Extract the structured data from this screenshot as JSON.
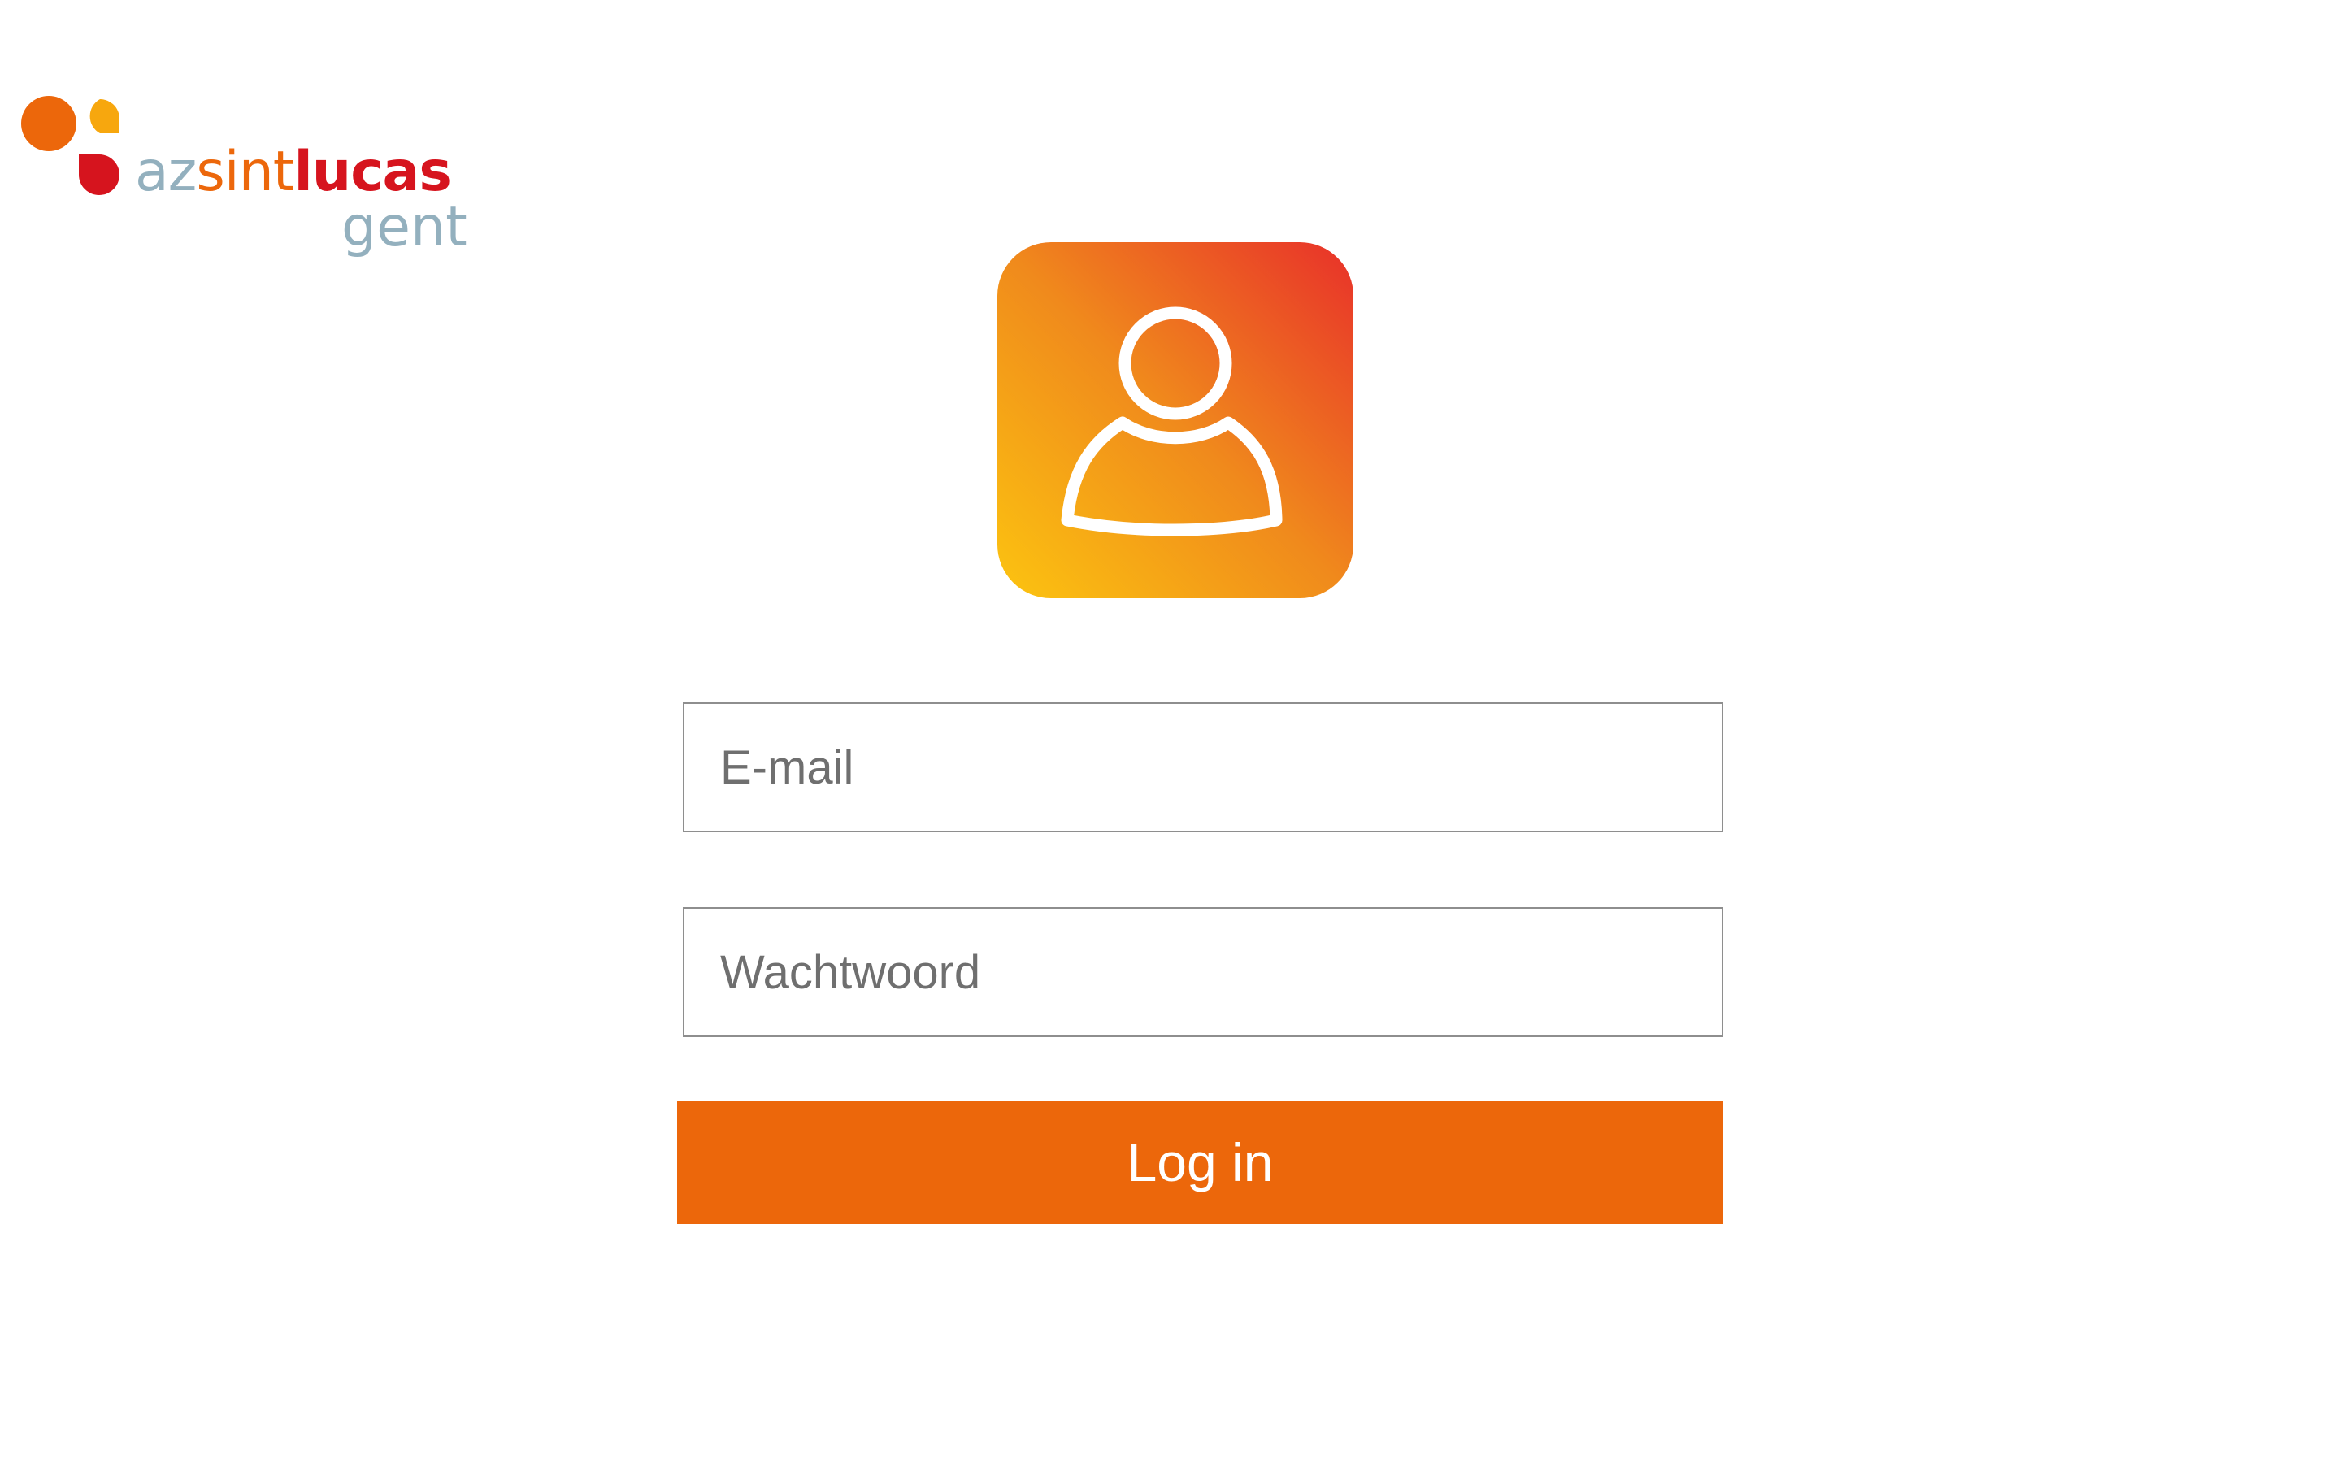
{
  "logo": {
    "alt": "az sint lucas gent",
    "word_az": "az",
    "word_sint": "sint",
    "word_lucas": "lucas",
    "word_city": "gent",
    "colors": {
      "az": "#93b0be",
      "sint": "#ec670b",
      "lucas": "#d6141e",
      "gent": "#93b0be",
      "dot_orange": "#ec670b",
      "dot_yellow": "#f7a70e",
      "dot_red": "#d6141e"
    }
  },
  "app_icon": {
    "icon": "user-icon",
    "gradient": [
      "#fcc410",
      "#f08a1c",
      "#e8302a"
    ]
  },
  "form": {
    "email_placeholder": "E-mail",
    "password_placeholder": "Wachtwoord",
    "login_label": "Log in"
  },
  "theme": {
    "accent": "#ec670b"
  }
}
